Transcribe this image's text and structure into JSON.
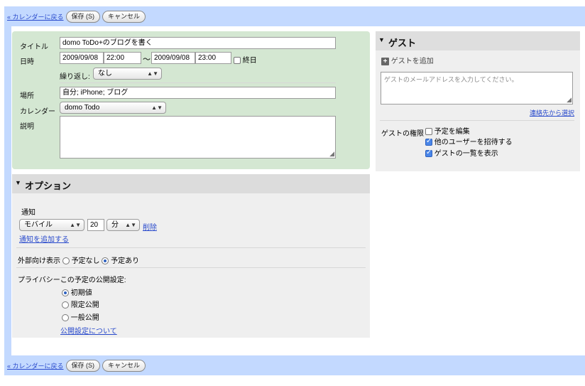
{
  "toolbar": {
    "back_link": "« カレンダーに戻る",
    "save_label": "保存 (S)",
    "cancel_label": "キャンセル"
  },
  "event": {
    "title_label": "タイトル",
    "title_value": "domo ToDo+のブログを書く",
    "when_label": "日時",
    "start_date": "2009/09/08",
    "start_time": "22:00",
    "range_sep": "〜",
    "end_date": "2009/09/08",
    "end_time": "23:00",
    "all_day_label": "終日",
    "repeat_label": "繰り返し:",
    "repeat_value": "なし",
    "where_label": "場所",
    "where_value": "自分; iPhone; ブログ",
    "calendar_label": "カレンダー",
    "calendar_value": "domo Todo",
    "description_label": "説明",
    "description_value": ""
  },
  "options": {
    "header": "オプション",
    "reminder_label": "通知",
    "reminder_method": "モバイル",
    "reminder_amount": "20",
    "reminder_unit": "分",
    "delete_link": "削除",
    "add_reminder_link": "通知を追加する",
    "show_me_as_label": "外部向け表示",
    "available_label": "予定なし",
    "busy_label": "予定あり",
    "privacy_label": "プライバシーこの予定の公開設定:",
    "privacy_default": "初期値",
    "privacy_private": "限定公開",
    "privacy_public": "一般公開",
    "privacy_help_link": "公開設定について"
  },
  "guests": {
    "header": "ゲスト",
    "add_guests_label": "ゲストを追加",
    "email_placeholder": "ゲストのメールアドレスを入力してください。",
    "choose_contacts_link": "連絡先から選択",
    "permissions_label": "ゲストの権限",
    "perm_modify": "予定を編集",
    "perm_invite": "他のユーザーを招待する",
    "perm_see_list": "ゲストの一覧を表示"
  },
  "colors": {
    "toolbar_bg": "#c3d9ff",
    "details_bg": "#d4e7d2",
    "panel_bg": "#efefef",
    "link": "#2a4bcc"
  }
}
